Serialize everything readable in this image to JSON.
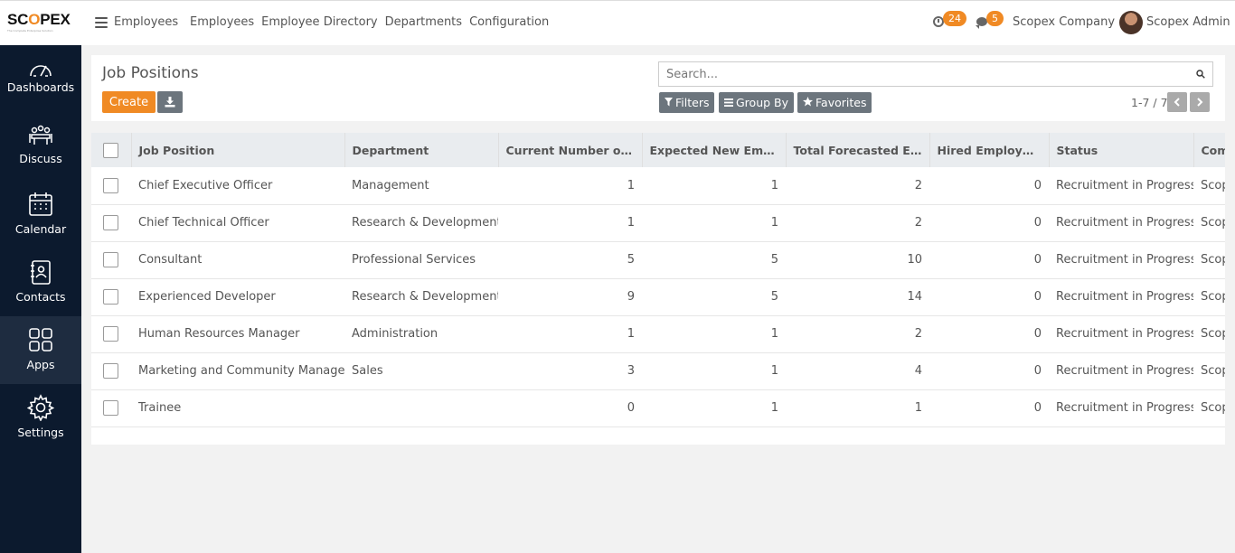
{
  "brand": {
    "logo_text": "SCOPEX",
    "tagline": "The Complete Enterprise Solution"
  },
  "topbar": {
    "app_name": "Employees",
    "menu": [
      "Employees",
      "Employee Directory",
      "Departments",
      "Configuration"
    ],
    "activity_count": "24",
    "message_count": "5",
    "company": "Scopex Company",
    "user": "Scopex Admin"
  },
  "sidebar": {
    "items": [
      {
        "label": "Dashboards",
        "icon": "gauge-icon"
      },
      {
        "label": "Discuss",
        "icon": "meeting-icon"
      },
      {
        "label": "Calendar",
        "icon": "calendar-icon"
      },
      {
        "label": "Contacts",
        "icon": "address-book-icon"
      },
      {
        "label": "Apps",
        "icon": "grid-icon",
        "active": true
      },
      {
        "label": "Settings",
        "icon": "gear-icon"
      }
    ]
  },
  "control_panel": {
    "title": "Job Positions",
    "create_label": "Create",
    "search_placeholder": "Search...",
    "filters_label": "Filters",
    "groupby_label": "Group By",
    "favorites_label": "Favorites",
    "pager_value": "1-7 / 7"
  },
  "table": {
    "columns": [
      "Job Position",
      "Department",
      "Current Number of Employees",
      "Expected New Employees",
      "Total Forecasted Employees",
      "Hired Employees",
      "Status",
      "Company"
    ],
    "rows": [
      {
        "job": "Chief Executive Officer",
        "dept": "Management",
        "current": "1",
        "expected": "1",
        "total": "2",
        "hired": "0",
        "status": "Recruitment in Progress",
        "company": "Scopex Company"
      },
      {
        "job": "Chief Technical Officer",
        "dept": "Research & Development",
        "current": "1",
        "expected": "1",
        "total": "2",
        "hired": "0",
        "status": "Recruitment in Progress",
        "company": "Scopex Company"
      },
      {
        "job": "Consultant",
        "dept": "Professional Services",
        "current": "5",
        "expected": "5",
        "total": "10",
        "hired": "0",
        "status": "Recruitment in Progress",
        "company": "Scopex Company"
      },
      {
        "job": "Experienced Developer",
        "dept": "Research & Development",
        "current": "9",
        "expected": "5",
        "total": "14",
        "hired": "0",
        "status": "Recruitment in Progress",
        "company": "Scopex Company"
      },
      {
        "job": "Human Resources Manager",
        "dept": "Administration",
        "current": "1",
        "expected": "1",
        "total": "2",
        "hired": "0",
        "status": "Recruitment in Progress",
        "company": "Scopex Company"
      },
      {
        "job": "Marketing and Community Manager",
        "dept": "Sales",
        "current": "3",
        "expected": "1",
        "total": "4",
        "hired": "0",
        "status": "Recruitment in Progress",
        "company": "Scopex Company"
      },
      {
        "job": "Trainee",
        "dept": "",
        "current": "0",
        "expected": "1",
        "total": "1",
        "hired": "0",
        "status": "Recruitment in Progress",
        "company": "Scopex Company"
      }
    ]
  },
  "colors": {
    "accent": "#f08a24",
    "sidebar_bg": "#0c1a2e",
    "sidebar_active": "#1e2c40",
    "button_gray": "#6c757d"
  }
}
